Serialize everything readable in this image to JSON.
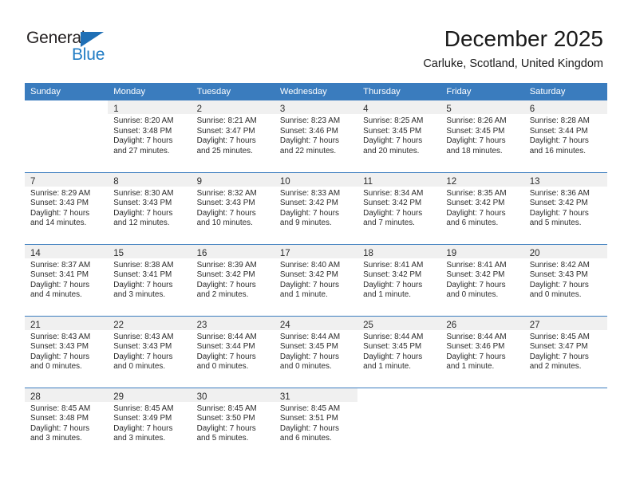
{
  "brand": {
    "name_dark": "General",
    "name_blue": "Blue",
    "accent_color": "#1f7bc4",
    "triangle_color": "#1f6fb5"
  },
  "header": {
    "title": "December 2025",
    "subtitle": "Carluke, Scotland, United Kingdom"
  },
  "theme": {
    "header_row_bg": "#3a7cbe",
    "header_row_text": "#ffffff",
    "daynum_band_bg": "#f0f0f0",
    "row_divider": "#3a7cbe"
  },
  "weekday_headers": [
    "Sunday",
    "Monday",
    "Tuesday",
    "Wednesday",
    "Thursday",
    "Friday",
    "Saturday"
  ],
  "weeks": [
    [
      {
        "day": "",
        "sunrise": "",
        "sunset": "",
        "daylight_line1": "",
        "daylight_line2": ""
      },
      {
        "day": "1",
        "sunrise": "Sunrise: 8:20 AM",
        "sunset": "Sunset: 3:48 PM",
        "daylight_line1": "Daylight: 7 hours",
        "daylight_line2": "and 27 minutes."
      },
      {
        "day": "2",
        "sunrise": "Sunrise: 8:21 AM",
        "sunset": "Sunset: 3:47 PM",
        "daylight_line1": "Daylight: 7 hours",
        "daylight_line2": "and 25 minutes."
      },
      {
        "day": "3",
        "sunrise": "Sunrise: 8:23 AM",
        "sunset": "Sunset: 3:46 PM",
        "daylight_line1": "Daylight: 7 hours",
        "daylight_line2": "and 22 minutes."
      },
      {
        "day": "4",
        "sunrise": "Sunrise: 8:25 AM",
        "sunset": "Sunset: 3:45 PM",
        "daylight_line1": "Daylight: 7 hours",
        "daylight_line2": "and 20 minutes."
      },
      {
        "day": "5",
        "sunrise": "Sunrise: 8:26 AM",
        "sunset": "Sunset: 3:45 PM",
        "daylight_line1": "Daylight: 7 hours",
        "daylight_line2": "and 18 minutes."
      },
      {
        "day": "6",
        "sunrise": "Sunrise: 8:28 AM",
        "sunset": "Sunset: 3:44 PM",
        "daylight_line1": "Daylight: 7 hours",
        "daylight_line2": "and 16 minutes."
      }
    ],
    [
      {
        "day": "7",
        "sunrise": "Sunrise: 8:29 AM",
        "sunset": "Sunset: 3:43 PM",
        "daylight_line1": "Daylight: 7 hours",
        "daylight_line2": "and 14 minutes."
      },
      {
        "day": "8",
        "sunrise": "Sunrise: 8:30 AM",
        "sunset": "Sunset: 3:43 PM",
        "daylight_line1": "Daylight: 7 hours",
        "daylight_line2": "and 12 minutes."
      },
      {
        "day": "9",
        "sunrise": "Sunrise: 8:32 AM",
        "sunset": "Sunset: 3:43 PM",
        "daylight_line1": "Daylight: 7 hours",
        "daylight_line2": "and 10 minutes."
      },
      {
        "day": "10",
        "sunrise": "Sunrise: 8:33 AM",
        "sunset": "Sunset: 3:42 PM",
        "daylight_line1": "Daylight: 7 hours",
        "daylight_line2": "and 9 minutes."
      },
      {
        "day": "11",
        "sunrise": "Sunrise: 8:34 AM",
        "sunset": "Sunset: 3:42 PM",
        "daylight_line1": "Daylight: 7 hours",
        "daylight_line2": "and 7 minutes."
      },
      {
        "day": "12",
        "sunrise": "Sunrise: 8:35 AM",
        "sunset": "Sunset: 3:42 PM",
        "daylight_line1": "Daylight: 7 hours",
        "daylight_line2": "and 6 minutes."
      },
      {
        "day": "13",
        "sunrise": "Sunrise: 8:36 AM",
        "sunset": "Sunset: 3:42 PM",
        "daylight_line1": "Daylight: 7 hours",
        "daylight_line2": "and 5 minutes."
      }
    ],
    [
      {
        "day": "14",
        "sunrise": "Sunrise: 8:37 AM",
        "sunset": "Sunset: 3:41 PM",
        "daylight_line1": "Daylight: 7 hours",
        "daylight_line2": "and 4 minutes."
      },
      {
        "day": "15",
        "sunrise": "Sunrise: 8:38 AM",
        "sunset": "Sunset: 3:41 PM",
        "daylight_line1": "Daylight: 7 hours",
        "daylight_line2": "and 3 minutes."
      },
      {
        "day": "16",
        "sunrise": "Sunrise: 8:39 AM",
        "sunset": "Sunset: 3:42 PM",
        "daylight_line1": "Daylight: 7 hours",
        "daylight_line2": "and 2 minutes."
      },
      {
        "day": "17",
        "sunrise": "Sunrise: 8:40 AM",
        "sunset": "Sunset: 3:42 PM",
        "daylight_line1": "Daylight: 7 hours",
        "daylight_line2": "and 1 minute."
      },
      {
        "day": "18",
        "sunrise": "Sunrise: 8:41 AM",
        "sunset": "Sunset: 3:42 PM",
        "daylight_line1": "Daylight: 7 hours",
        "daylight_line2": "and 1 minute."
      },
      {
        "day": "19",
        "sunrise": "Sunrise: 8:41 AM",
        "sunset": "Sunset: 3:42 PM",
        "daylight_line1": "Daylight: 7 hours",
        "daylight_line2": "and 0 minutes."
      },
      {
        "day": "20",
        "sunrise": "Sunrise: 8:42 AM",
        "sunset": "Sunset: 3:43 PM",
        "daylight_line1": "Daylight: 7 hours",
        "daylight_line2": "and 0 minutes."
      }
    ],
    [
      {
        "day": "21",
        "sunrise": "Sunrise: 8:43 AM",
        "sunset": "Sunset: 3:43 PM",
        "daylight_line1": "Daylight: 7 hours",
        "daylight_line2": "and 0 minutes."
      },
      {
        "day": "22",
        "sunrise": "Sunrise: 8:43 AM",
        "sunset": "Sunset: 3:43 PM",
        "daylight_line1": "Daylight: 7 hours",
        "daylight_line2": "and 0 minutes."
      },
      {
        "day": "23",
        "sunrise": "Sunrise: 8:44 AM",
        "sunset": "Sunset: 3:44 PM",
        "daylight_line1": "Daylight: 7 hours",
        "daylight_line2": "and 0 minutes."
      },
      {
        "day": "24",
        "sunrise": "Sunrise: 8:44 AM",
        "sunset": "Sunset: 3:45 PM",
        "daylight_line1": "Daylight: 7 hours",
        "daylight_line2": "and 0 minutes."
      },
      {
        "day": "25",
        "sunrise": "Sunrise: 8:44 AM",
        "sunset": "Sunset: 3:45 PM",
        "daylight_line1": "Daylight: 7 hours",
        "daylight_line2": "and 1 minute."
      },
      {
        "day": "26",
        "sunrise": "Sunrise: 8:44 AM",
        "sunset": "Sunset: 3:46 PM",
        "daylight_line1": "Daylight: 7 hours",
        "daylight_line2": "and 1 minute."
      },
      {
        "day": "27",
        "sunrise": "Sunrise: 8:45 AM",
        "sunset": "Sunset: 3:47 PM",
        "daylight_line1": "Daylight: 7 hours",
        "daylight_line2": "and 2 minutes."
      }
    ],
    [
      {
        "day": "28",
        "sunrise": "Sunrise: 8:45 AM",
        "sunset": "Sunset: 3:48 PM",
        "daylight_line1": "Daylight: 7 hours",
        "daylight_line2": "and 3 minutes."
      },
      {
        "day": "29",
        "sunrise": "Sunrise: 8:45 AM",
        "sunset": "Sunset: 3:49 PM",
        "daylight_line1": "Daylight: 7 hours",
        "daylight_line2": "and 3 minutes."
      },
      {
        "day": "30",
        "sunrise": "Sunrise: 8:45 AM",
        "sunset": "Sunset: 3:50 PM",
        "daylight_line1": "Daylight: 7 hours",
        "daylight_line2": "and 5 minutes."
      },
      {
        "day": "31",
        "sunrise": "Sunrise: 8:45 AM",
        "sunset": "Sunset: 3:51 PM",
        "daylight_line1": "Daylight: 7 hours",
        "daylight_line2": "and 6 minutes."
      },
      {
        "day": "",
        "sunrise": "",
        "sunset": "",
        "daylight_line1": "",
        "daylight_line2": ""
      },
      {
        "day": "",
        "sunrise": "",
        "sunset": "",
        "daylight_line1": "",
        "daylight_line2": ""
      },
      {
        "day": "",
        "sunrise": "",
        "sunset": "",
        "daylight_line1": "",
        "daylight_line2": ""
      }
    ]
  ]
}
